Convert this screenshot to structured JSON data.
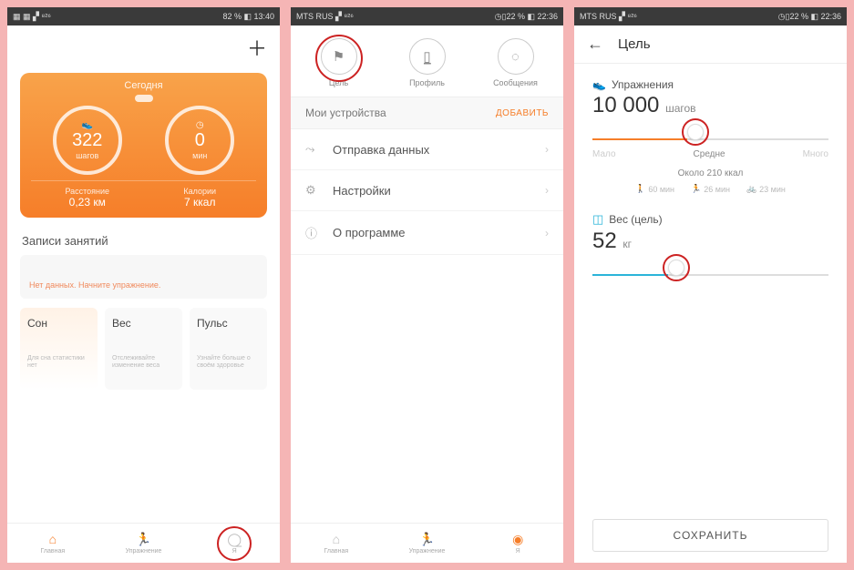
{
  "screen1": {
    "statusbar": {
      "left": "▦ ▦ ▞ ⁸²⁶",
      "right": "82 % ◧ 13:40"
    },
    "card": {
      "title": "Сегодня",
      "steps_value": "322",
      "steps_label": "шагов",
      "time_value": "0",
      "time_label": "мин",
      "distance_label": "Расстояние",
      "distance_value": "0,23 км",
      "calories_label": "Калории",
      "calories_value": "7 ккал"
    },
    "activity": {
      "title": "Записи занятий",
      "empty_text": "Нет данных. Начните упражнение."
    },
    "tiles": {
      "sleep": {
        "title": "Сон",
        "sub": "Для сна статистики нет"
      },
      "weight": {
        "title": "Вес",
        "sub": "Отслеживайте изменение веса"
      },
      "pulse": {
        "title": "Пульс",
        "sub": "Узнайте больше о своём здоровье"
      }
    },
    "nav": {
      "home": "Главная",
      "exercise": "Упражнение",
      "me": "Я"
    }
  },
  "screen2": {
    "statusbar": {
      "left": "MTS RUS ▞ ⁸²⁶",
      "right": "◷▯22 % ◧ 22:36"
    },
    "top": {
      "goal": "Цель",
      "profile": "Профиль",
      "messages": "Сообщения"
    },
    "devices": {
      "label": "Мои устройства",
      "add": "ДОБАВИТЬ"
    },
    "rows": {
      "data": "Отправка данных",
      "settings": "Настройки",
      "about": "О программе"
    },
    "nav": {
      "home": "Главная",
      "exercise": "Упражнение",
      "me": "Я"
    }
  },
  "screen3": {
    "statusbar": {
      "left": "MTS RUS ▞ ⁸²⁶",
      "right": "◷▯22 % ◧ 22:36"
    },
    "title": "Цель",
    "exercise": {
      "label": "Упражнения",
      "value": "10 000",
      "unit": "шагов",
      "low": "Мало",
      "mid": "Средне",
      "high": "Много",
      "kcal": "Около 210 ккал",
      "walk": "60 мин",
      "run": "26 мин",
      "bike": "23 мин"
    },
    "weight": {
      "label": "Вес (цель)",
      "value": "52",
      "unit": "кг"
    },
    "save": "СОХРАНИТЬ"
  }
}
